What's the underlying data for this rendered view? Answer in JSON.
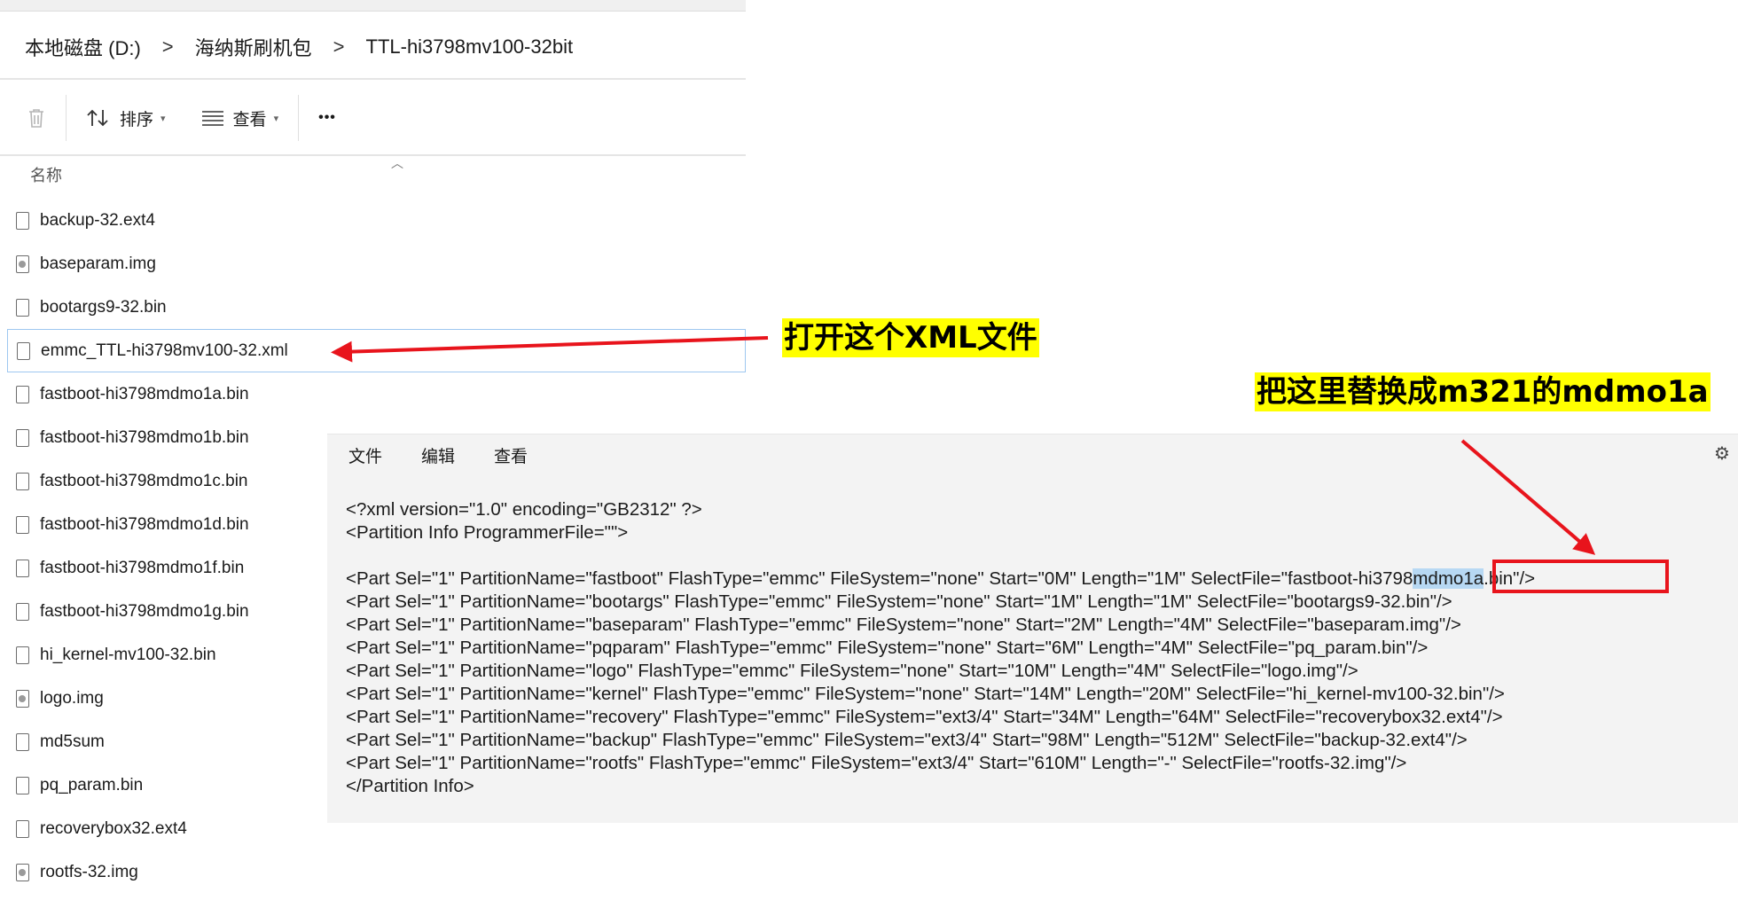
{
  "explorer": {
    "breadcrumb": [
      "本地磁盘 (D:)",
      "海纳斯刷机包",
      "TTL-hi3798mv100-32bit"
    ],
    "separator": ">",
    "toolbar": {
      "sort_label": "排序",
      "view_label": "查看",
      "more_label": "•••"
    },
    "column_header": "名称",
    "files": [
      {
        "name": "backup-32.ext4",
        "icon": "file-icon"
      },
      {
        "name": "baseparam.img",
        "icon": "image-file-icon"
      },
      {
        "name": "bootargs9-32.bin",
        "icon": "file-icon"
      },
      {
        "name": "emmc_TTL-hi3798mv100-32.xml",
        "icon": "file-icon",
        "selected": true
      },
      {
        "name": "fastboot-hi3798mdmo1a.bin",
        "icon": "file-icon"
      },
      {
        "name": "fastboot-hi3798mdmo1b.bin",
        "icon": "file-icon"
      },
      {
        "name": "fastboot-hi3798mdmo1c.bin",
        "icon": "file-icon"
      },
      {
        "name": "fastboot-hi3798mdmo1d.bin",
        "icon": "file-icon"
      },
      {
        "name": "fastboot-hi3798mdmo1f.bin",
        "icon": "file-icon"
      },
      {
        "name": "fastboot-hi3798mdmo1g.bin",
        "icon": "file-icon"
      },
      {
        "name": "hi_kernel-mv100-32.bin",
        "icon": "file-icon"
      },
      {
        "name": "logo.img",
        "icon": "image-file-icon"
      },
      {
        "name": "md5sum",
        "icon": "file-icon"
      },
      {
        "name": "pq_param.bin",
        "icon": "file-icon"
      },
      {
        "name": "recoverybox32.ext4",
        "icon": "file-icon"
      },
      {
        "name": "rootfs-32.img",
        "icon": "image-file-icon"
      }
    ]
  },
  "editor": {
    "menu": [
      "文件",
      "编辑",
      "查看"
    ],
    "lines": [
      "<?xml version=\"1.0\" encoding=\"GB2312\" ?>",
      "<Partition Info ProgrammerFile=\"\">",
      "",
      "<Part Sel=\"1\" PartitionName=\"bootargs\" FlashType=\"emmc\" FileSystem=\"none\" Start=\"1M\" Length=\"1M\" SelectFile=\"bootargs9-32.bin\"/>",
      "<Part Sel=\"1\" PartitionName=\"baseparam\" FlashType=\"emmc\" FileSystem=\"none\" Start=\"2M\" Length=\"4M\" SelectFile=\"baseparam.img\"/>",
      "<Part Sel=\"1\" PartitionName=\"pqparam\" FlashType=\"emmc\" FileSystem=\"none\" Start=\"6M\" Length=\"4M\" SelectFile=\"pq_param.bin\"/>",
      "<Part Sel=\"1\" PartitionName=\"logo\" FlashType=\"emmc\" FileSystem=\"none\" Start=\"10M\" Length=\"4M\" SelectFile=\"logo.img\"/>",
      "<Part Sel=\"1\" PartitionName=\"kernel\" FlashType=\"emmc\" FileSystem=\"none\" Start=\"14M\" Length=\"20M\" SelectFile=\"hi_kernel-mv100-32.bin\"/>",
      "<Part Sel=\"1\" PartitionName=\"recovery\" FlashType=\"emmc\" FileSystem=\"ext3/4\" Start=\"34M\" Length=\"64M\" SelectFile=\"recoverybox32.ext4\"/>",
      "<Part Sel=\"1\" PartitionName=\"backup\" FlashType=\"emmc\" FileSystem=\"ext3/4\" Start=\"98M\" Length=\"512M\" SelectFile=\"backup-32.ext4\"/>",
      "<Part Sel=\"1\" PartitionName=\"rootfs\" FlashType=\"emmc\" FileSystem=\"ext3/4\" Start=\"610M\" Length=\"-\" SelectFile=\"rootfs-32.img\"/>",
      "</Partition Info>"
    ],
    "fastboot_line": {
      "before": "<Part Sel=\"1\" PartitionName=\"fastboot\" FlashType=\"emmc\" FileSystem=\"none\" Start=\"0M\" Length=\"1M\" SelectFile=\"fastboot-hi3798",
      "selected": "mdmo1a",
      "after": ".bin\"/>"
    }
  },
  "annotations": {
    "open_xml": "打开这个XML文件",
    "replace_hint": "把这里替换成m321的mdmo1a"
  },
  "colors": {
    "highlight": "#ffff00",
    "arrow": "#e8141c",
    "selection": "#b7d8f3"
  }
}
